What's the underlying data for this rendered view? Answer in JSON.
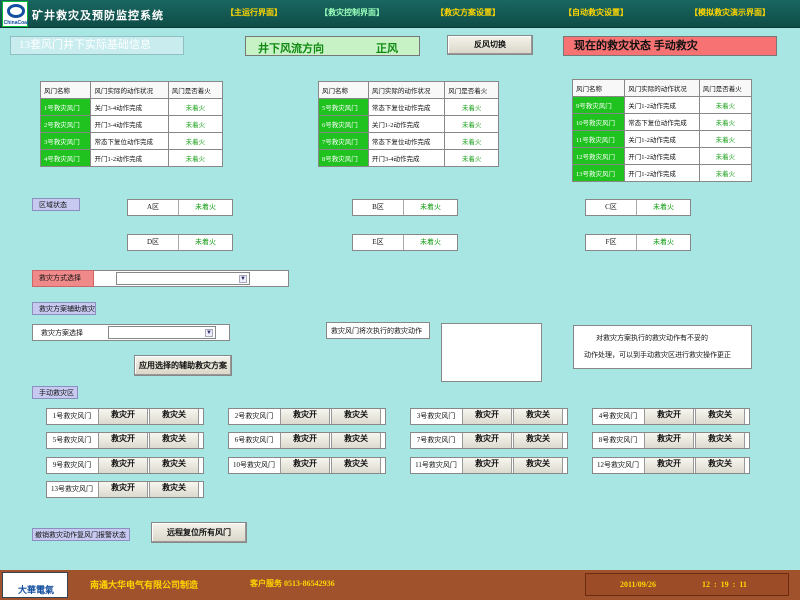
{
  "header": {
    "logo_text": "ChinaCoal",
    "title": "矿井救灾及预防监控系统",
    "nav": [
      {
        "label": "【主运行界面】"
      },
      {
        "label": "【救灾控制界面】"
      },
      {
        "label": "【救灾方案设置】"
      },
      {
        "label": "【自动救灾设置】"
      },
      {
        "label": "【模拟救灾演示界面】"
      }
    ]
  },
  "top": {
    "info_button": "13套风门井下实际基础信息",
    "airflow_label": "井下风流方向",
    "airflow_value": "正风",
    "reverse_button": "反风切换",
    "state_text": "现在的救灾状态   手动救灾"
  },
  "tables": {
    "headers": [
      "风门名称",
      "风门实际的动作状况",
      "风门是否着火"
    ],
    "t1": [
      {
        "name": "1号救灾风门",
        "action": "关门3-4动作完成",
        "fire": "未着火"
      },
      {
        "name": "2号救灾风门",
        "action": "开门3-4动作完成",
        "fire": "未着火"
      },
      {
        "name": "3号救灾风门",
        "action": "常态下复位动作完成",
        "fire": "未着火"
      },
      {
        "name": "4号救灾风门",
        "action": "开门1-2动作完成",
        "fire": "未着火"
      }
    ],
    "t2": [
      {
        "name": "5号救灾风门",
        "action": "常态下复位动作完成",
        "fire": "未着火"
      },
      {
        "name": "6号救灾风门",
        "action": "关门1-2动作完成",
        "fire": "未着火"
      },
      {
        "name": "7号救灾风门",
        "action": "常态下复位动作完成",
        "fire": "未着火"
      },
      {
        "name": "8号救灾风门",
        "action": "开门3-4动作完成",
        "fire": "未着火"
      }
    ],
    "t3": [
      {
        "name": "9号救灾风门",
        "action": "关门1-2动作完成",
        "fire": "未着火"
      },
      {
        "name": "10号救灾风门",
        "action": "常态下复位动作完成",
        "fire": "未着火"
      },
      {
        "name": "11号救灾风门",
        "action": "关门1-2动作完成",
        "fire": "未着火"
      },
      {
        "name": "12号救灾风门",
        "action": "开门1-2动作完成",
        "fire": "未着火"
      },
      {
        "name": "13号救灾风门",
        "action": "开门1-2动作完成",
        "fire": "未着火"
      }
    ]
  },
  "zones": {
    "title": "区域状态",
    "items": [
      {
        "zone": "A区",
        "status": "未着火"
      },
      {
        "zone": "B区",
        "status": "未着火"
      },
      {
        "zone": "C区",
        "status": "未着火"
      },
      {
        "zone": "D区",
        "status": "未着火"
      },
      {
        "zone": "E区",
        "status": "未着火"
      },
      {
        "zone": "F区",
        "status": "未着火"
      }
    ]
  },
  "rescue": {
    "mode_label": "救灾方式选择",
    "mode_value": "",
    "aux_title": "救灾方案辅助救灾",
    "plan_label": "救灾方案选择",
    "plan_value": "",
    "apply_button": "应用选择的辅助救灾方案",
    "next_action_label": "救灾风门将次执行的救灾动作",
    "note_line1": "对救灾方案执行的救灾动作有不妥的",
    "note_line2": "动作处理，可以到手动救灾区进行救灾操作更正"
  },
  "manual": {
    "title": "手动救灾区",
    "open_label": "救灾开",
    "close_label": "救灾关",
    "doors": [
      "1号救灾风门",
      "2号救灾风门",
      "3号救灾风门",
      "4号救灾风门",
      "5号救灾风门",
      "6号救灾风门",
      "7号救灾风门",
      "8号救灾风门",
      "9号救灾风门",
      "10号救灾风门",
      "11号救灾风门",
      "12号救灾风门",
      "13号救灾风门"
    ]
  },
  "bottom": {
    "clear_label": "撤销救灾动作复风门报警状态",
    "reset_button": "远程复位所有风门"
  },
  "footer": {
    "company": "南通大华电气有限公司制造",
    "service": "客户服务 0513-86542936",
    "date": "2011/09/26",
    "time": "12  :  19  :  11",
    "logo_text": "大華電氣"
  },
  "colors": {
    "background": "#a8e6e3",
    "header": "#1a6660",
    "footer": "#a0522d",
    "state_banner": "#f77272",
    "airflow_banner": "#c6f2c6",
    "door_name_green": "#1fc21f",
    "status_green": "#1aa01a"
  }
}
